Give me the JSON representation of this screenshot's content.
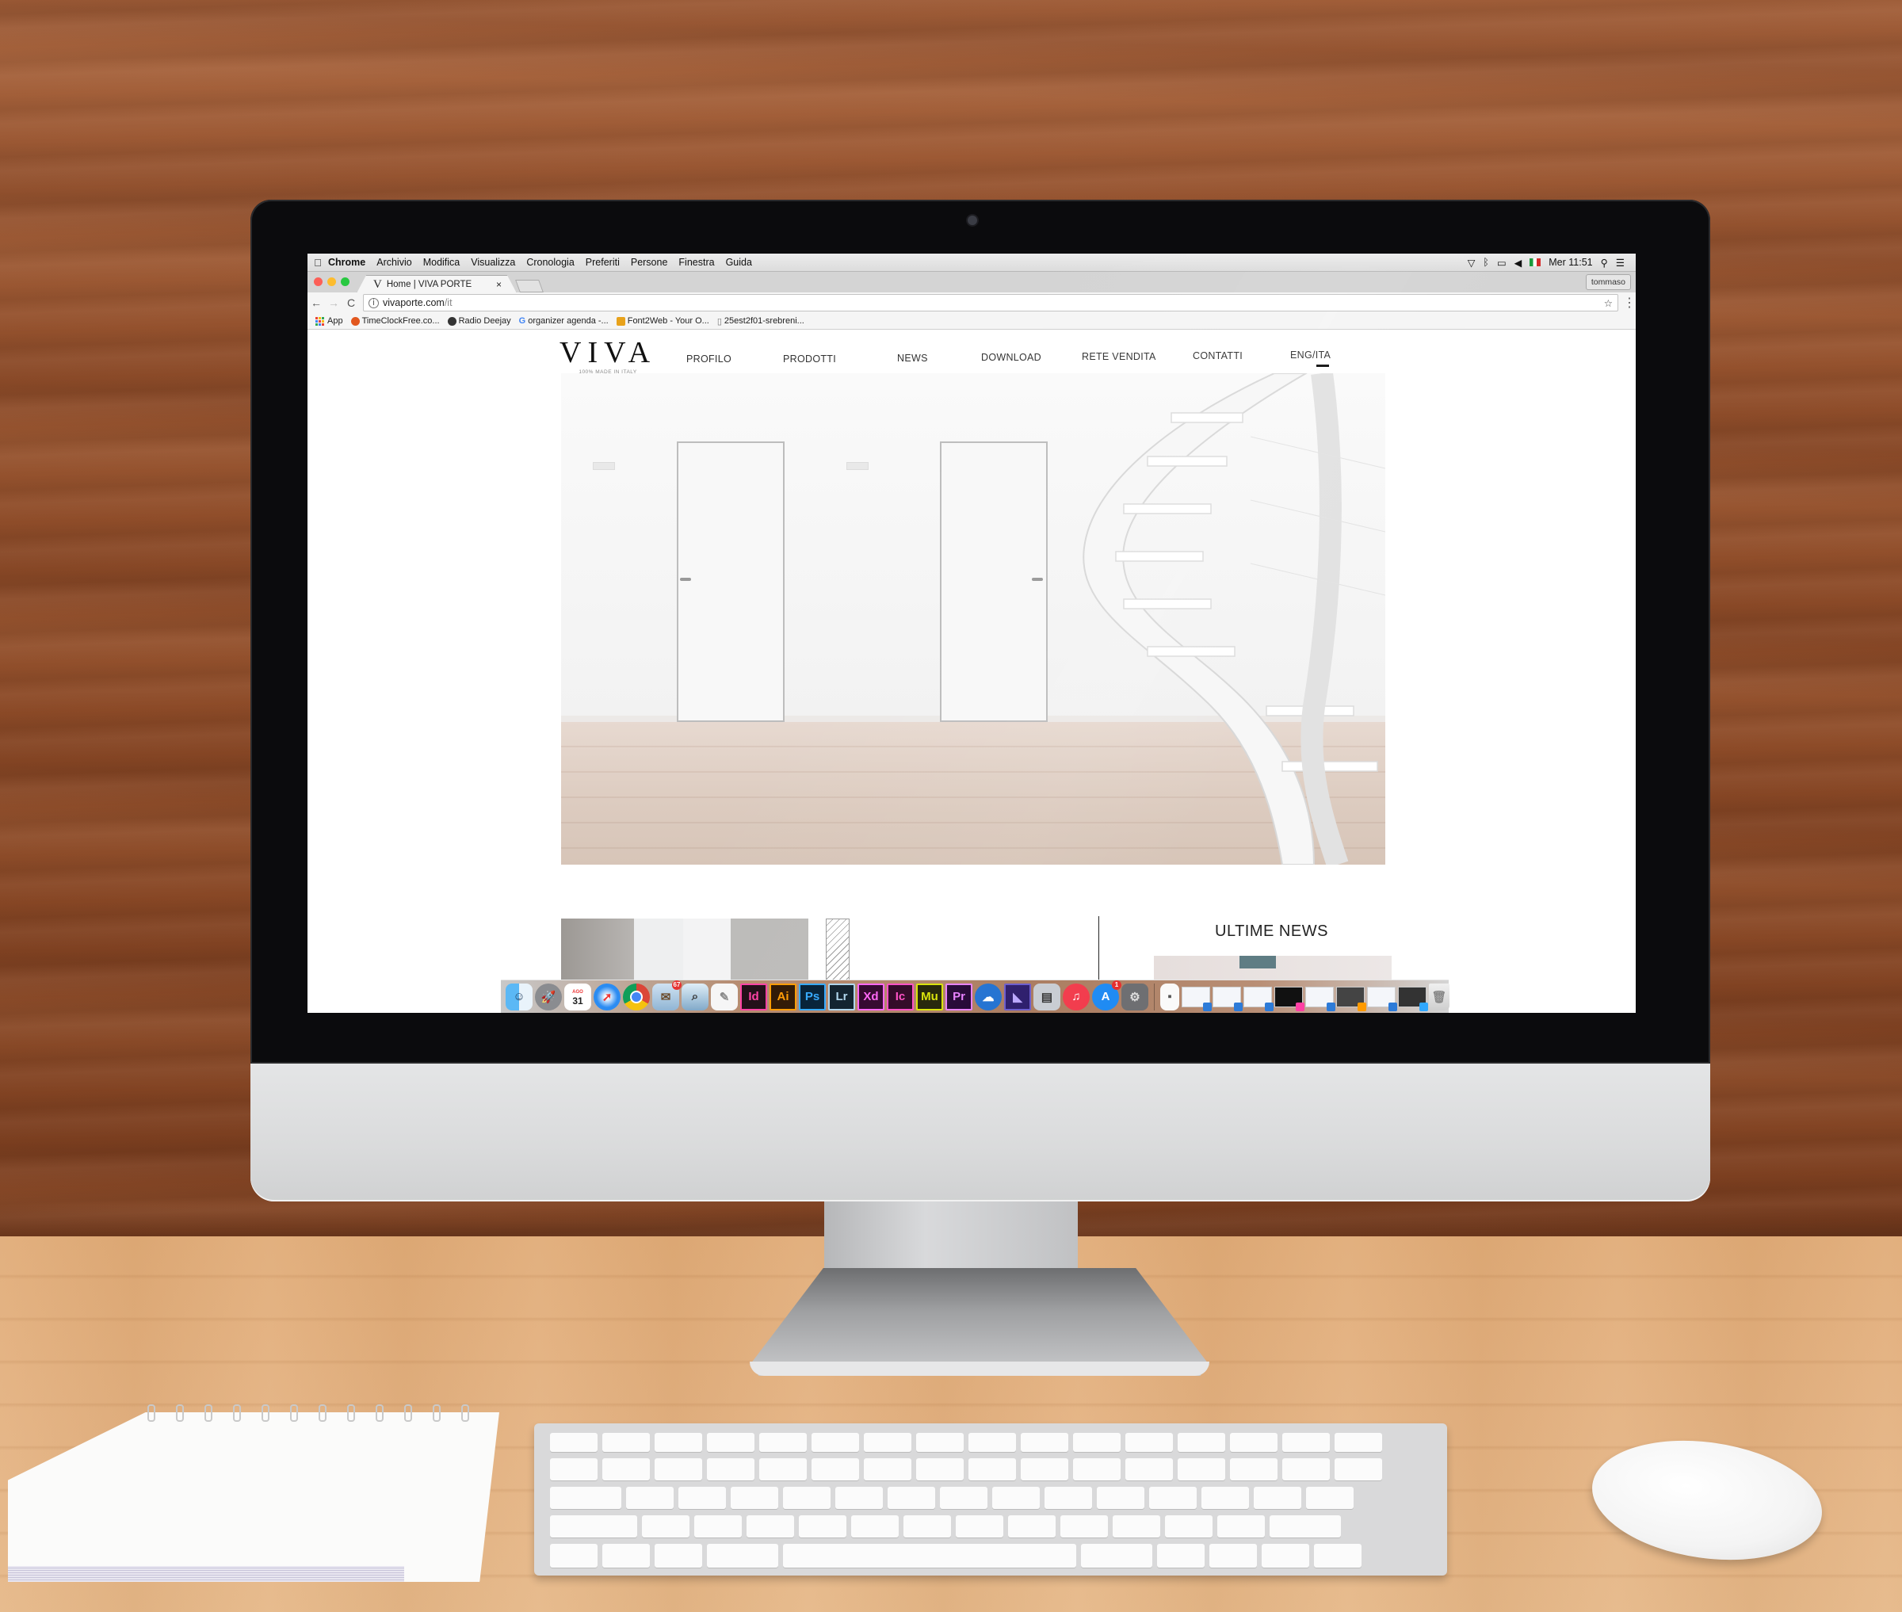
{
  "menubar": {
    "apple_icon": "apple-logo-icon",
    "items": [
      "Chrome",
      "Archivio",
      "Modifica",
      "Visualizza",
      "Cronologia",
      "Preferiti",
      "Persone",
      "Finestra",
      "Guida"
    ],
    "status_icons": [
      "wifi-icon",
      "bluetooth-icon",
      "airplay-icon",
      "volume-icon",
      "italian-flag-icon"
    ],
    "clock": "Mer 11:51",
    "spotlight_icon": "search-icon",
    "notifications_icon": "list-icon"
  },
  "browser": {
    "tab": {
      "favicon": "V",
      "title": "Home | VIVA PORTE",
      "close": "×"
    },
    "profile_button": "tommaso",
    "nav": {
      "back": "←",
      "forward": "→",
      "reload": "C"
    },
    "url": {
      "host": "vivaporte.com",
      "path": "/it",
      "info": "i"
    },
    "star": "☆",
    "menu": "⋮",
    "bookmarks": [
      {
        "label": "App",
        "icon": "apps-grid-icon"
      },
      {
        "label": "TimeClockFree.co...",
        "icon": "timeclock-icon",
        "color": "#e2571e"
      },
      {
        "label": "Radio Deejay",
        "icon": "radio-deejay-icon",
        "color": "#333333"
      },
      {
        "label": "organizer agenda -...",
        "icon": "google-icon",
        "color": "#4285f4"
      },
      {
        "label": "Font2Web - Your O...",
        "icon": "font2web-icon",
        "color": "#e8a21b"
      },
      {
        "label": "25est2f01-srebreni...",
        "icon": "document-icon",
        "color": "#777777"
      }
    ]
  },
  "site": {
    "logo": "VIVA",
    "tagline": "100% MADE IN ITALY",
    "nav": [
      "PROFILO",
      "PRODOTTI",
      "NEWS",
      "DOWNLOAD",
      "RETE VENDITA",
      "CONTATTI",
      "ENG/ITA"
    ],
    "news_heading": "ULTIME NEWS"
  },
  "dock": {
    "apps": [
      {
        "name": "finder",
        "label": ""
      },
      {
        "name": "launchpad",
        "label": ""
      },
      {
        "name": "calendar",
        "label": "31",
        "sub": "AGO"
      },
      {
        "name": "safari",
        "label": ""
      },
      {
        "name": "chrome",
        "label": ""
      },
      {
        "name": "mail",
        "label": "",
        "badge": "67"
      },
      {
        "name": "preview",
        "label": ""
      },
      {
        "name": "textedit",
        "label": ""
      },
      {
        "name": "indesign",
        "label": "Id",
        "color": "#ff3fa4"
      },
      {
        "name": "illustrator",
        "label": "Ai",
        "color": "#ff9a00"
      },
      {
        "name": "photoshop",
        "label": "Ps",
        "color": "#31a8ff"
      },
      {
        "name": "lightroom",
        "label": "Lr",
        "color": "#add5ec"
      },
      {
        "name": "xd",
        "label": "Xd",
        "color": "#ff61f6"
      },
      {
        "name": "incopy",
        "label": "Ic",
        "color": "#ff4ac4"
      },
      {
        "name": "muse",
        "label": "Mu",
        "color": "#d8e300"
      },
      {
        "name": "premiere",
        "label": "Pr",
        "color": "#e77cff"
      },
      {
        "name": "openoffice",
        "label": ""
      },
      {
        "name": "media-encoder",
        "label": ""
      },
      {
        "name": "image-capture",
        "label": ""
      },
      {
        "name": "itunes",
        "label": ""
      },
      {
        "name": "app-store",
        "label": "",
        "badge": "1"
      },
      {
        "name": "system-preferences",
        "label": ""
      }
    ],
    "documents": [
      {
        "name": "disk-image",
        "corner": ""
      },
      {
        "name": "finder-doc-1",
        "corner": "#2d7bd8"
      },
      {
        "name": "finder-doc-2",
        "corner": "#2d7bd8"
      },
      {
        "name": "finder-doc-3",
        "corner": "#2d7bd8"
      },
      {
        "name": "indesign-doc",
        "corner": "#ff3fa4"
      },
      {
        "name": "finder-doc-4",
        "corner": "#2d7bd8"
      },
      {
        "name": "illustrator-doc",
        "corner": "#ff9a00"
      },
      {
        "name": "finder-doc-5",
        "corner": "#2d7bd8"
      },
      {
        "name": "photoshop-doc",
        "corner": "#31a8ff"
      },
      {
        "name": "trash",
        "corner": ""
      }
    ]
  },
  "colors": {
    "traffic_close": "#fc5f57",
    "traffic_min": "#fdbc2e",
    "traffic_max": "#28c840"
  }
}
